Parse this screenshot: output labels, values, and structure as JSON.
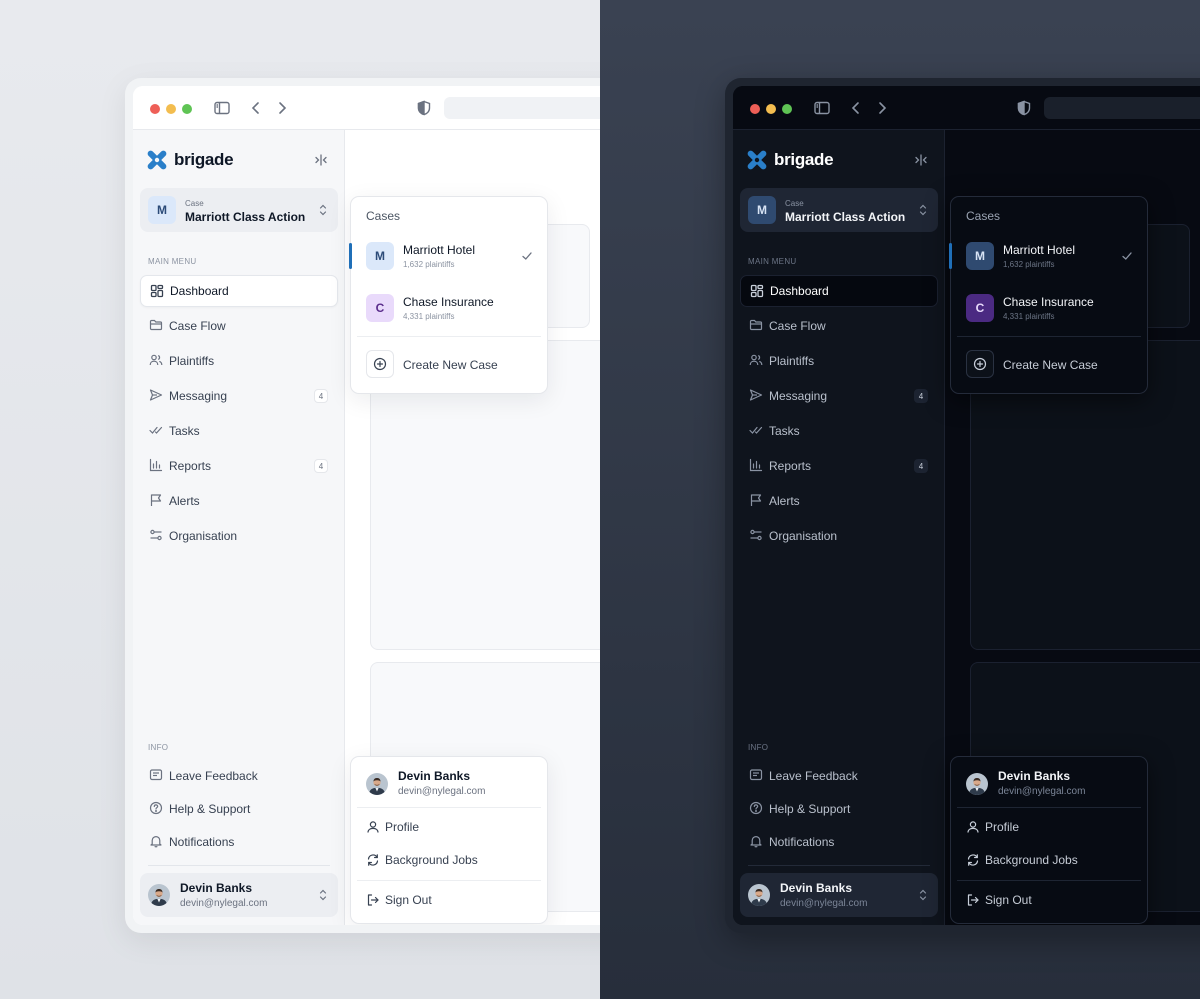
{
  "brand": {
    "name": "brigade",
    "accent": "#1f6fb8"
  },
  "case_selector": {
    "label": "Case",
    "current": "Marriott Class Action",
    "initial": "M"
  },
  "sections": {
    "main_menu": "MAIN MENU",
    "info": "INFO"
  },
  "nav": [
    {
      "label": "Dashboard",
      "icon": "dashboard-icon",
      "active": true
    },
    {
      "label": "Case Flow",
      "icon": "folder-icon"
    },
    {
      "label": "Plaintiffs",
      "icon": "users-icon"
    },
    {
      "label": "Messaging",
      "icon": "send-icon",
      "badge": "4"
    },
    {
      "label": "Tasks",
      "icon": "double-check-icon"
    },
    {
      "label": "Reports",
      "icon": "bar-chart-icon",
      "badge": "4"
    },
    {
      "label": "Alerts",
      "icon": "flag-icon"
    },
    {
      "label": "Organisation",
      "icon": "sliders-icon"
    }
  ],
  "info": [
    {
      "label": "Leave Feedback",
      "icon": "feedback-icon"
    },
    {
      "label": "Help & Support",
      "icon": "help-icon"
    },
    {
      "label": "Notifications",
      "icon": "bell-icon"
    }
  ],
  "user": {
    "name": "Devin Banks",
    "email": "devin@nylegal.com"
  },
  "cases_popover": {
    "title": "Cases",
    "items": [
      {
        "initial": "M",
        "name": "Marriott Hotel",
        "sub": "1,632 plaintiffs",
        "selected": true
      },
      {
        "initial": "C",
        "name": "Chase Insurance",
        "sub": "4,331 plaintiffs",
        "selected": false
      }
    ],
    "create_label": "Create New Case"
  },
  "user_menu": {
    "items": [
      {
        "label": "Profile",
        "icon": "user-icon"
      },
      {
        "label": "Background Jobs",
        "icon": "refresh-icon"
      },
      {
        "label": "Sign Out",
        "icon": "sign-out-icon"
      }
    ]
  }
}
